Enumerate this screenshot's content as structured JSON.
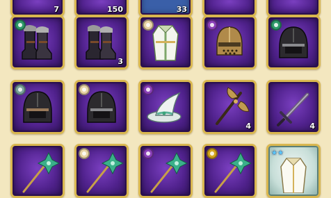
{
  "colors": {
    "panel_bg": "#f3e7bf",
    "slot_border": "#d9b74f",
    "slot_fill": "#52238f"
  },
  "top_row": [
    {
      "name": "partial-slot-1",
      "count": "7"
    },
    {
      "name": "partial-slot-2",
      "count": "150"
    },
    {
      "name": "partial-slot-3",
      "count": "33"
    },
    {
      "name": "partial-slot-4",
      "count": ""
    },
    {
      "name": "partial-slot-5",
      "count": ""
    }
  ],
  "rows": [
    [
      {
        "item": "boots-icon",
        "badge": "#2e9a6a",
        "count": ""
      },
      {
        "item": "boots-icon",
        "badge": "",
        "count": "3"
      },
      {
        "item": "robe-icon",
        "badge": "#e8d3a4",
        "count": ""
      },
      {
        "item": "knight-helmet-icon",
        "badge": "#8a3fb8",
        "count": ""
      },
      {
        "item": "hood-helmet-icon",
        "badge": "#2e9a6a",
        "count": ""
      }
    ],
    [
      {
        "item": "hood-helmet-icon",
        "badge": "#7aa39a",
        "count": ""
      },
      {
        "item": "hood-helmet-icon",
        "badge": "#e8d3a4",
        "count": ""
      },
      {
        "item": "wizard-hat-icon",
        "badge": "#8a3fb8",
        "count": ""
      },
      {
        "item": "battle-axe-icon",
        "badge": "",
        "count": "4"
      },
      {
        "item": "sword-icon",
        "badge": "",
        "count": "4"
      }
    ],
    [
      {
        "item": "staff-icon",
        "badge": "",
        "count": ""
      },
      {
        "item": "staff-icon",
        "badge": "#e8d3a4",
        "count": ""
      },
      {
        "item": "staff-icon",
        "badge": "#8a3fb8",
        "count": ""
      },
      {
        "item": "staff-icon",
        "badge": "#d4a51c",
        "count": ""
      },
      {
        "item": "robe-icon",
        "badge": "",
        "count": "",
        "stars": "★★",
        "rare": true
      }
    ]
  ]
}
